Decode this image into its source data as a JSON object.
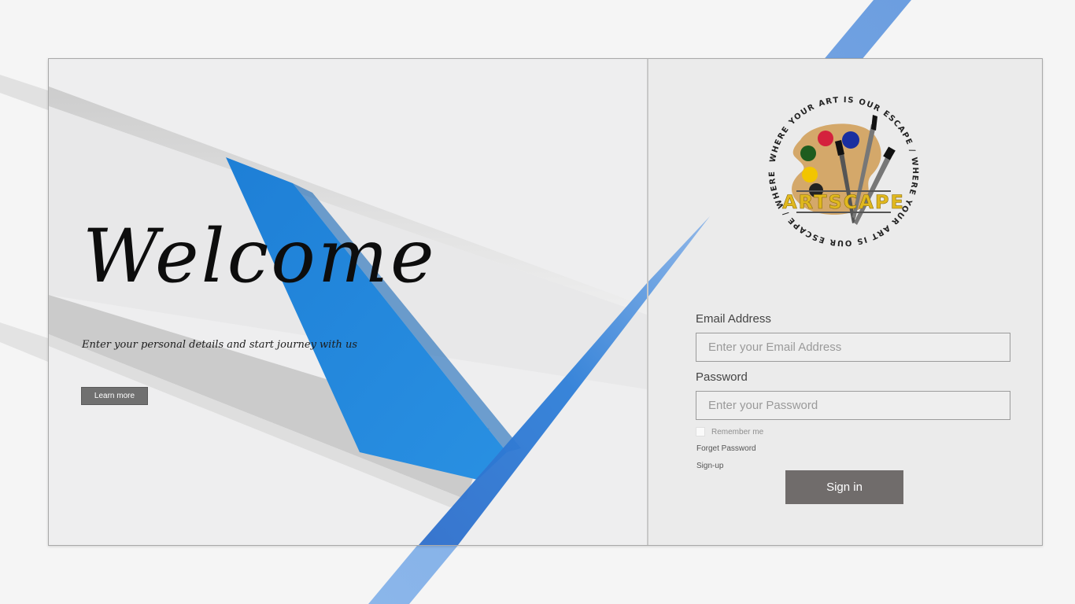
{
  "hero": {
    "title": "Welcome",
    "tagline": "Enter your personal details and start journey with us",
    "learn_more_label": "Learn more"
  },
  "logo": {
    "brand": "ARTSCAPE",
    "ring_text": "WHERE YOUR ART IS OUR ESCAPE / WHERE YOUR ART IS OUR ESCAPE / WHERE YOUR ART IS OUR",
    "paint_colors": [
      "#d4213d",
      "#1a2fa0",
      "#1e5c1e",
      "#f2c500"
    ]
  },
  "form": {
    "email_label": "Email Address",
    "email_placeholder": "Enter your Email Address",
    "email_value": "",
    "password_label": "Password",
    "password_placeholder": "Enter your Password",
    "password_value": "",
    "remember_label": "Remember me",
    "forget_label": "Forget Password",
    "signup_label": "Sign-up",
    "signin_label": "Sign in"
  },
  "colors": {
    "accent_blue": "#1f87dc",
    "stripe_blue": "#7aa9e6",
    "button_gray": "#706c6b"
  }
}
